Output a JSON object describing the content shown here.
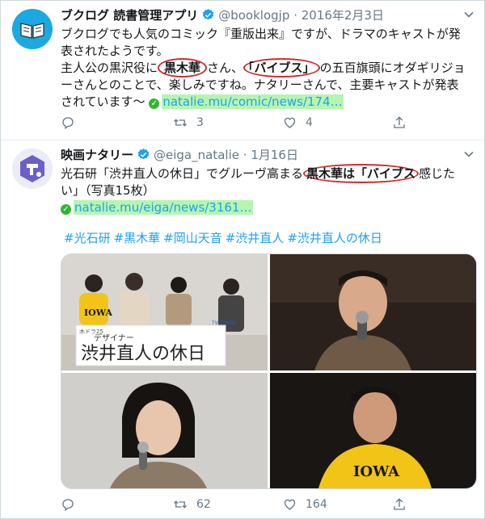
{
  "tweet1": {
    "display_name": "ブクログ 読書管理アプリ",
    "handle": "@booklogjp",
    "separator": "·",
    "date": "2016年2月3日",
    "line1": "ブクログでも人気のコミック『重版出来』ですが、ドラマのキャストが発表されたようです。",
    "line2_pre": "主人公の黒沢役に",
    "circled_a": "黒木華",
    "line2_mid": "さん、",
    "circled_b": "「バイブス」",
    "line2_post": "の五百旗頭にオダギリジョーさんとのことで、楽しみですね。ナタリーさんで、主要キャストが発表されています〜",
    "link": "natalie.mu/comic/news/174…",
    "counts": {
      "reply": "",
      "retweet": "3",
      "like": "4"
    }
  },
  "tweet2": {
    "display_name": "映画ナタリー",
    "handle": "@eiga_natalie",
    "separator": "·",
    "date": "1月16日",
    "line1_pre": "光石研「渋井直人の休日」でグルーヴ高まる",
    "circled": "黒木華は「バイブス",
    "line1_post": "感じたい」（写真15枚）",
    "link": "natalie.mu/eiga/news/3161…",
    "hashtags": [
      "#光石研",
      "#黒木華",
      "#岡山天音",
      "#渋井直人",
      "#渋井直人の休日"
    ],
    "counts": {
      "reply": "",
      "retweet": "62",
      "like": "164"
    },
    "photo_banner": {
      "small": "木ドラ25",
      "subtitle": "デザイナー",
      "title": "渋井直人の休日",
      "channel": "TV TOKYO"
    },
    "shirt_text": "IOWA"
  },
  "colors": {
    "link": "#1da1f2",
    "highlight": "#b6f5b0",
    "circle": "#d42a2a",
    "verified": "#1da1f2"
  }
}
